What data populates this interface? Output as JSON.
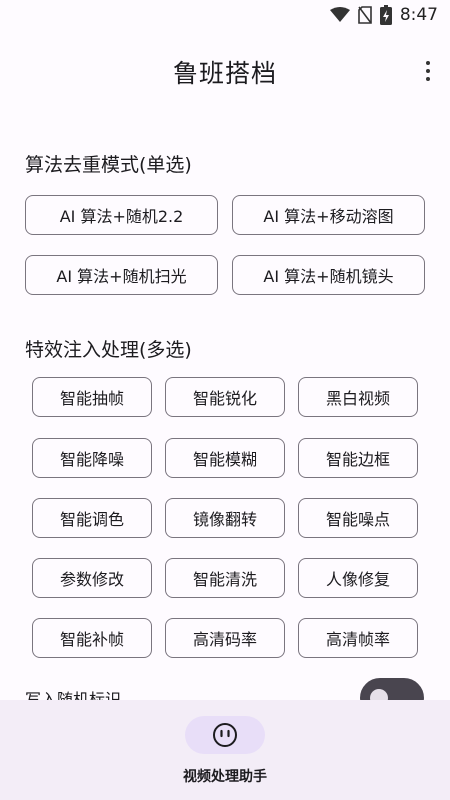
{
  "status_bar": {
    "time": "8:47"
  },
  "app_bar": {
    "title": "鲁班搭档"
  },
  "dedupe_section": {
    "title": "算法去重模式(单选)",
    "options": [
      "AI 算法+随机2.2",
      "AI 算法+移动溶图",
      "AI 算法+随机扫光",
      "AI 算法+随机镜头"
    ]
  },
  "effects_section": {
    "title": "特效注入处理(多选)",
    "options": [
      "智能抽帧",
      "智能锐化",
      "黑白视频",
      "智能降噪",
      "智能模糊",
      "智能边框",
      "智能调色",
      "镜像翻转",
      "智能噪点",
      "参数修改",
      "智能清洗",
      "人像修复",
      "智能补帧",
      "高清码率",
      "高清帧率"
    ]
  },
  "toggle": {
    "label": "写入随机标识"
  },
  "bottom_nav": {
    "label": "视频处理助手"
  }
}
